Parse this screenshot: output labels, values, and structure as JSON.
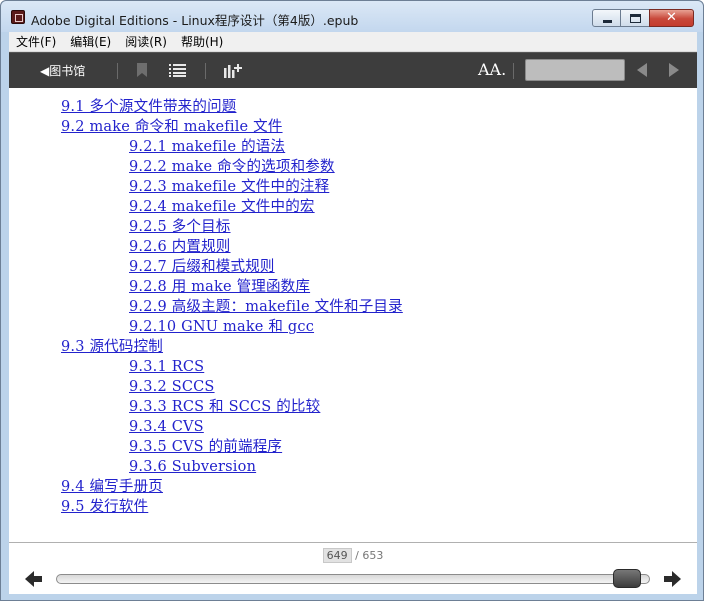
{
  "window": {
    "title": "Adobe Digital Editions - Linux程序设计（第4版）.epub",
    "controls": {
      "minimize": "minimize",
      "maximize": "maximize",
      "close": "✕"
    }
  },
  "menu": {
    "items": [
      "文件(F)",
      "编辑(E)",
      "阅读(R)",
      "帮助(H)"
    ]
  },
  "toolbar": {
    "library_label": "◀图书馆",
    "font_size_label": "AA.",
    "search_placeholder": "",
    "icons": [
      "bookmark-icon",
      "toc-icon",
      "stats-icon",
      "font-size-icon",
      "prev-arrow-icon",
      "next-arrow-icon"
    ]
  },
  "toc": {
    "entries": [
      {
        "level": 1,
        "text": "9.1  多个源文件带来的问题"
      },
      {
        "level": 1,
        "text": "9.2  make 命令和 makefile 文件"
      },
      {
        "level": 2,
        "text": "9.2.1  makefile 的语法"
      },
      {
        "level": 2,
        "text": "9.2.2  make 命令的选项和参数"
      },
      {
        "level": 2,
        "text": "9.2.3  makefile 文件中的注释"
      },
      {
        "level": 2,
        "text": "9.2.4  makefile 文件中的宏"
      },
      {
        "level": 2,
        "text": "9.2.5  多个目标"
      },
      {
        "level": 2,
        "text": "9.2.6  内置规则"
      },
      {
        "level": 2,
        "text": "9.2.7  后缀和模式规则"
      },
      {
        "level": 2,
        "text": "9.2.8  用 make 管理函数库"
      },
      {
        "level": 2,
        "text": "9.2.9  高级主题：makefile 文件和子目录"
      },
      {
        "level": 2,
        "text": "9.2.10  GNU make 和 gcc"
      },
      {
        "level": 1,
        "text": "9.3  源代码控制"
      },
      {
        "level": 2,
        "text": "9.3.1  RCS"
      },
      {
        "level": 2,
        "text": "9.3.2  SCCS"
      },
      {
        "level": 2,
        "text": "9.3.3  RCS 和 SCCS 的比较"
      },
      {
        "level": 2,
        "text": "9.3.4  CVS"
      },
      {
        "level": 2,
        "text": "9.3.5  CVS 的前端程序"
      },
      {
        "level": 2,
        "text": "9.3.6  Subversion"
      },
      {
        "level": 1,
        "text": "9.4  编写手册页"
      },
      {
        "level": 1,
        "text": "9.5  发行软件"
      }
    ]
  },
  "footer": {
    "current_page": "649",
    "total_pages": "/ 653",
    "progress_fraction": 0.994
  },
  "colors": {
    "link": "#2222cc",
    "toolbar": "#3d3d3d",
    "frame": "#bcd3ea"
  }
}
